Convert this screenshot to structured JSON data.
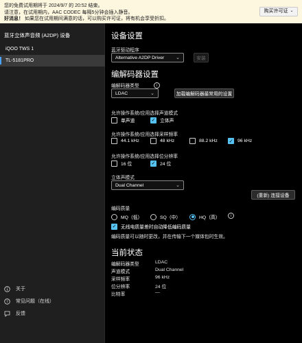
{
  "banner": {
    "line1": "您的免费试用期将于 2024/9/7 的 20:52 结束。",
    "line2": "请注意，在试用期内，AAC CODEC 每隔5分钟会插入静音。",
    "line3_bold": "好消息！",
    "line3": "如果您在试用期间满意的话，可以购买许可证，将有机会享受折扣。",
    "buy_label": "购买许可证"
  },
  "sidebar": {
    "title": "蓝牙立体声音频 (A2DP) 设备",
    "items": [
      {
        "label": "iQOO TWS 1"
      },
      {
        "label": "TL-5181PRO"
      }
    ],
    "bottom": {
      "about": "关于",
      "faq": "常见问题（在线）",
      "feedback": "反馈"
    }
  },
  "main": {
    "device_settings": {
      "heading": "设备设置",
      "driver_label": "蓝牙驱动程序",
      "driver_value": "Alternative A2DP Driver",
      "install_label": "安装"
    },
    "codec_settings": {
      "heading": "编解码器设置",
      "codec_type_label": "编解码器类型",
      "codec_type_value": "LDAC",
      "load_more_label": "加载编解码器最常用的设置"
    },
    "channel_mode": {
      "label": "允许操作系统/应用选择声道模式",
      "options": [
        {
          "label": "单声道",
          "checked": false
        },
        {
          "label": "立体声",
          "checked": true
        }
      ]
    },
    "sample_rate": {
      "label": "允许操作系统/应用选择采样频率",
      "options": [
        {
          "label": "44.1 kHz",
          "checked": false
        },
        {
          "label": "48 kHz",
          "checked": false
        },
        {
          "label": "88.2 kHz",
          "checked": false
        },
        {
          "label": "96 kHz",
          "checked": true
        }
      ]
    },
    "bit_depth": {
      "label": "允许操作系统/应用选择位分辨率",
      "options": [
        {
          "label": "16 位",
          "checked": false
        },
        {
          "label": "24 位",
          "checked": true
        }
      ]
    },
    "stereo_mode": {
      "label": "立体声模式",
      "value": "Dual Channel",
      "reconnect_label": "(重新) 连接设备"
    },
    "quality": {
      "label": "编码质量",
      "options": [
        {
          "label": "MQ（低）",
          "selected": false
        },
        {
          "label": "SQ（中）",
          "selected": false
        },
        {
          "label": "HQ（高）",
          "selected": true
        }
      ],
      "adaptive_label": "无线电质量差时自动降低编码质量",
      "adaptive_checked": true,
      "note": "编码质量可以随时更改，并在传输下一个媒体包时生效。"
    },
    "status": {
      "heading": "当前状态",
      "rows": [
        {
          "k": "编解码器类型",
          "v": "LDAC"
        },
        {
          "k": "声道模式",
          "v": "Dual Channel"
        },
        {
          "k": "采样频率",
          "v": "96 kHz"
        },
        {
          "k": "位分辨率",
          "v": "24 位"
        },
        {
          "k": "比特率",
          "v": "—"
        }
      ]
    }
  },
  "colors": {
    "accent": "#56c2f2",
    "banner_bg": "#fdf7e0",
    "sidebar_bg": "#1f1f1f",
    "main_bg": "#000000"
  }
}
